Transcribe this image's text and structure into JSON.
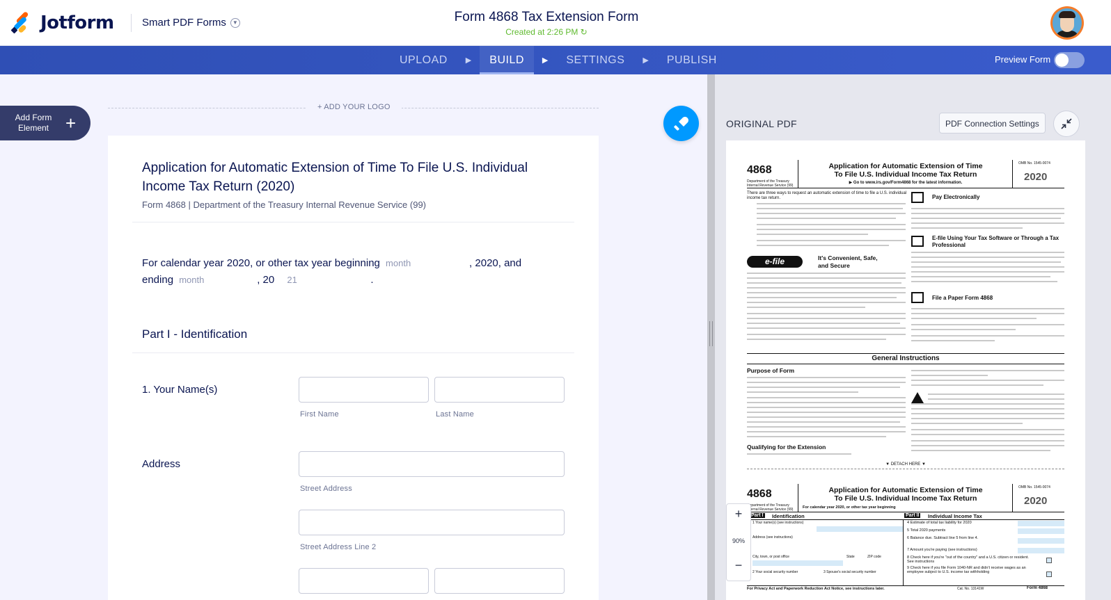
{
  "header": {
    "brand": "Jotform",
    "product": "Smart PDF Forms",
    "form_title": "Form 4868 Tax Extension Form",
    "created": "Created at 2:26 PM",
    "created_color": "#5fba2f"
  },
  "nav": {
    "tabs": [
      "UPLOAD",
      "BUILD",
      "SETTINGS",
      "PUBLISH"
    ],
    "active": "BUILD",
    "preview_label": "Preview Form",
    "bar_color": "#3558c4"
  },
  "builder": {
    "add_element": "Add Form Element",
    "add_logo": "+ ADD YOUR LOGO",
    "form": {
      "heading": "Application for Automatic Extension of Time To File U.S. Individual Income Tax Return (2020)",
      "subheading": "Form 4868 | Department of the Treasury Internal Revenue Service (99)",
      "paragraph": {
        "p1": "For calendar year 2020, or other tax year beginning",
        "month1": "month",
        "p2": ", 2020, and",
        "p3": "ending",
        "month2": "month",
        "p4": ", 20",
        "year": "21",
        "p5": "."
      },
      "part1_title": "Part I - Identification",
      "name_label": "1. Your Name(s)",
      "first_name": "First Name",
      "last_name": "Last Name",
      "address_label": "Address",
      "street": "Street Address",
      "street2": "Street Address Line 2"
    }
  },
  "pdf": {
    "title": "ORIGINAL PDF",
    "connection_button": "PDF Connection Settings",
    "zoom": "90%",
    "zoom_in": "+",
    "zoom_out": "−",
    "page": {
      "form_no": "Form 4868",
      "form_no_big": "4868",
      "dept": "Department of the Treasury Internal Revenue Service (99)",
      "heading1": "Application for Automatic Extension of Time",
      "heading2": "To File U.S. Individual Income Tax Return",
      "goto": "▶ Go to www.irs.gov/Form4868 for the latest information.",
      "omb": "OMB No. 1545-0074",
      "year": "2020",
      "intro": "There are three ways to request an automatic extension of time to file a U.S. individual income tax return.",
      "pay_electronically": "Pay Electronically",
      "efile_software": "E-file Using Your Tax Software or Through a Tax Professional",
      "paper_form": "File a Paper Form 4868",
      "convenient": "It's Convenient, Safe, and Secure",
      "efile_logo": "e-file",
      "general": "General Instructions",
      "purpose": "Purpose of Form",
      "qualifying": "Qualifying for the Extension",
      "detach": "▼ DETACH HERE ▼",
      "part1": "Part I",
      "identification": "Identification",
      "part2": "Part II",
      "individual_tax": "Individual Income Tax",
      "calendar": "For calendar year 2020, or other tax year beginning",
      "line4": "4  Estimate of total tax liability for 2020",
      "line5": "5  Total 2020 payments",
      "line6": "6  Balance due. Subtract line 5 from line 4.",
      "line7": "7  Amount you're paying (see instructions)",
      "line8": "8  Check here if you're \"out of the country\" and a U.S. citizen or resident. See instructions",
      "line9": "9  Check here if you file Form 1040-NR and didn't receive wages as an employee subject to U.S. income tax withholding",
      "names": "1  Your name(s) (see instructions)",
      "address": "Address (see instructions)",
      "city": "City, town, or post office",
      "state": "State",
      "zip": "ZIP code",
      "ssn": "2  Your social security number",
      "spouse": "3  Spouse's social security number",
      "footer": "For Privacy Act and Paperwork Reduction Act Notice, see instructions later.",
      "cat": "Cat. No. 13141W"
    }
  }
}
